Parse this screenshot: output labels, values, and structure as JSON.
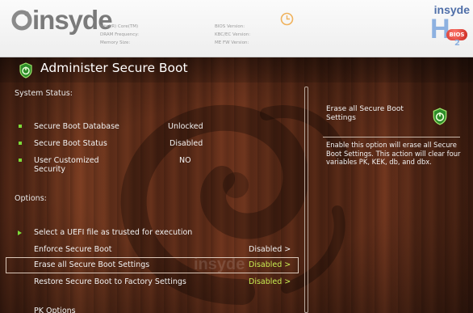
{
  "header": {
    "brand": "insyde",
    "labels_left": [
      "Intel(R) Core(TM)",
      "DRAM Frequency:",
      "Memory Size:"
    ],
    "labels_right": [
      "BIOS Version:",
      "KBC/EC Version:",
      "ME FW Version:"
    ],
    "right_logo": {
      "word": "insyde",
      "letter": "H",
      "badge": "BIOS",
      "sub": "2"
    }
  },
  "page": {
    "title": "Administer Secure Boot"
  },
  "system_status": {
    "label": "System Status:",
    "items": [
      {
        "label": "Secure Boot Database",
        "value": "Unlocked"
      },
      {
        "label": "Secure Boot Status",
        "value": "Disabled"
      },
      {
        "label": "User Customized Security",
        "value": "NO"
      }
    ]
  },
  "options": {
    "label": "Options:",
    "uefi_item": "Select a UEFI file as trusted for execution",
    "items": [
      {
        "label": "Enforce Secure Boot",
        "value": "Disabled >",
        "selected": false
      },
      {
        "label": "Erase all Secure Boot Settings",
        "value": "Disabled >",
        "selected": true
      },
      {
        "label": "Restore Secure Boot to Factory Settings",
        "value": "Disabled >",
        "selected": false
      }
    ],
    "cut_item": "PK Options"
  },
  "help": {
    "title": "Erase all Secure Boot Settings",
    "text": "Enable this option will erase all Secure Boot Settings. This action will clear four variables PK, KEK, db, and dbx."
  },
  "colors": {
    "accent_green": "#7ddc3a",
    "selected_value": "#c8ee53"
  }
}
